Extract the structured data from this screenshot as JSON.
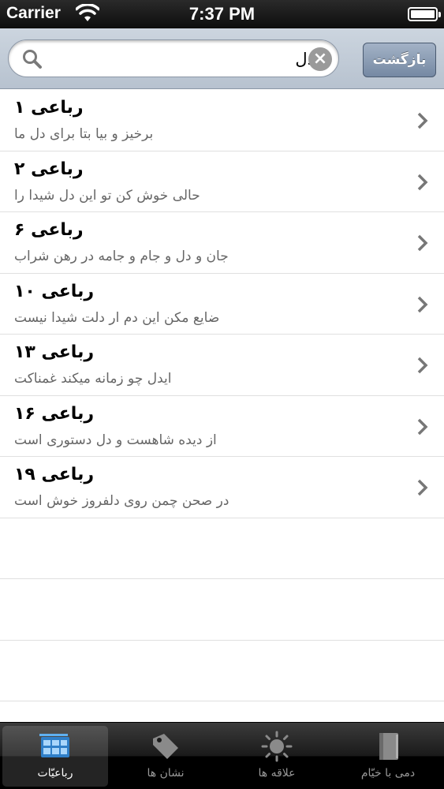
{
  "status_bar": {
    "carrier": "Carrier",
    "time": "7:37 PM"
  },
  "search": {
    "value": "دل",
    "back_label": "بازگشت"
  },
  "results": [
    {
      "title": "رباعی ۱",
      "subtitle": "برخیز و بیا بتا برای دل ما"
    },
    {
      "title": "رباعی ۲",
      "subtitle": "حالی خوش کن تو این دل شیدا را"
    },
    {
      "title": "رباعی ۶",
      "subtitle": "جان و دل و جام و جامه در رهن شراب"
    },
    {
      "title": "رباعی ۱۰",
      "subtitle": "ضایع مکن این دم ار دلت شیدا نیست"
    },
    {
      "title": "رباعی ۱۳",
      "subtitle": "ایدل چو زمانه ميكند غمناكت"
    },
    {
      "title": "رباعی ۱۶",
      "subtitle": "از دیده شاهست و دل دستوری است"
    },
    {
      "title": "رباعی ۱۹",
      "subtitle": "در صحن چمن روی دلفروز خوش است"
    }
  ],
  "tabs": [
    {
      "label": "رباعیّات",
      "icon": "rubaiyat-grid-icon",
      "selected": true
    },
    {
      "label": "نشان ها",
      "icon": "bookmark-tag-icon",
      "selected": false
    },
    {
      "label": "علاقه ها",
      "icon": "sun-favorites-icon",
      "selected": false
    },
    {
      "label": "دمی با خیّام",
      "icon": "book-icon",
      "selected": false
    }
  ],
  "colors": {
    "status_bar": "#0d0d0d",
    "search_bar": "#c1cbd7",
    "back_button": "#7589a3",
    "subtitle": "#666666",
    "tab_bar": "#000000",
    "tab_icon_selected": "#4aa3e8"
  }
}
